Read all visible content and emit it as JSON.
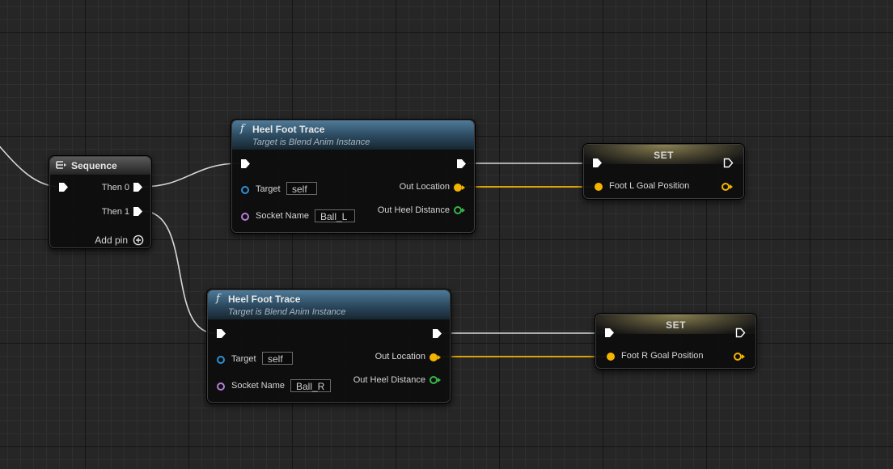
{
  "sequence_node": {
    "title": "Sequence",
    "icon": "sequence-icon",
    "outputs": [
      "Then 0",
      "Then 1"
    ],
    "add_pin_label": "Add pin"
  },
  "heel_trace_nodes": [
    {
      "title": "Heel Foot Trace",
      "subtitle": "Target is Blend Anim Instance",
      "target_label": "Target",
      "target_value": "self",
      "socket_label": "Socket Name",
      "socket_value": "Ball_L",
      "out_location_label": "Out Location",
      "out_heel_distance_label": "Out Heel Distance"
    },
    {
      "title": "Heel Foot Trace",
      "subtitle": "Target is Blend Anim Instance",
      "target_label": "Target",
      "target_value": "self",
      "socket_label": "Socket Name",
      "socket_value": "Ball_R",
      "out_location_label": "Out Location",
      "out_heel_distance_label": "Out Heel Distance"
    }
  ],
  "set_nodes": [
    {
      "title": "SET",
      "variable_label": "Foot L Goal Position"
    },
    {
      "title": "SET",
      "variable_label": "Foot R Goal Position"
    }
  ],
  "colors": {
    "exec_pin": "#ffffff",
    "vector_pin": "#f4b400",
    "object_pin": "#2f8fd3",
    "name_pin": "#b57ed8",
    "float_pin": "#38b54a",
    "function_header": "#2d4c62",
    "grid_background": "#262626"
  }
}
